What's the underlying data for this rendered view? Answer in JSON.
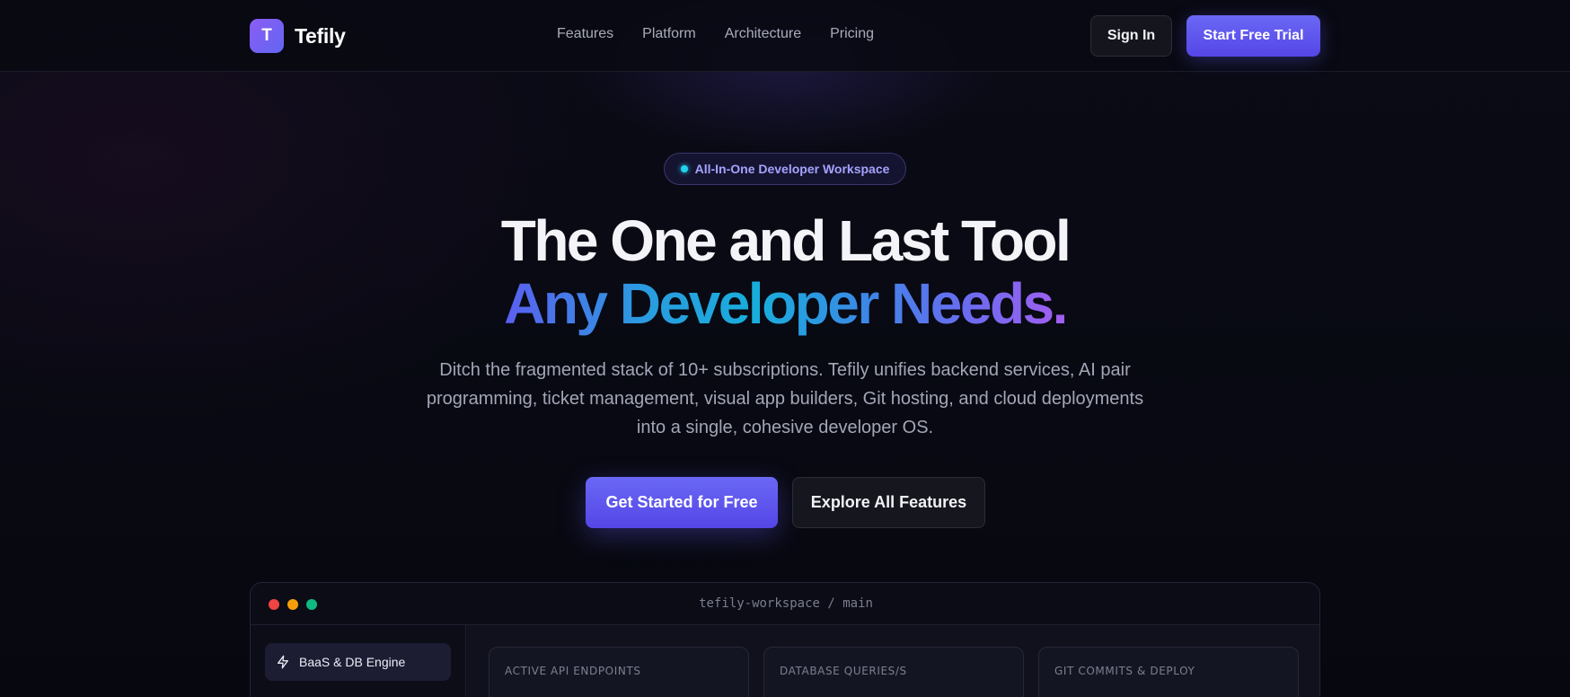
{
  "brand": {
    "logo_letter": "T",
    "name": "Tefily",
    "accent": "#6366f1"
  },
  "nav": {
    "links": [
      "Features",
      "Platform",
      "Architecture",
      "Pricing"
    ],
    "sign_in": "Sign In",
    "trial": "Start Free Trial"
  },
  "hero": {
    "badge": "All-In-One Developer Workspace",
    "title_line1": "The One and Last Tool",
    "title_line2": "Any Developer Needs.",
    "subtitle": "Ditch the fragmented stack of 10+ subscriptions. Tefily unifies backend services, AI pair programming, ticket management, visual app builders, Git hosting, and cloud deployments into a single, cohesive developer OS.",
    "cta_primary": "Get Started for Free",
    "cta_secondary": "Explore All Features"
  },
  "workspace": {
    "title": "tefily-workspace / main",
    "sidebar": [
      {
        "label": "BaaS & DB Engine",
        "icon": "lightning-icon"
      }
    ],
    "stats": [
      {
        "label": "ACTIVE API ENDPOINTS",
        "value": ""
      },
      {
        "label": "DATABASE QUERIES/S",
        "value": ""
      },
      {
        "label": "GIT COMMITS & DEPLOY",
        "value": ""
      }
    ]
  }
}
